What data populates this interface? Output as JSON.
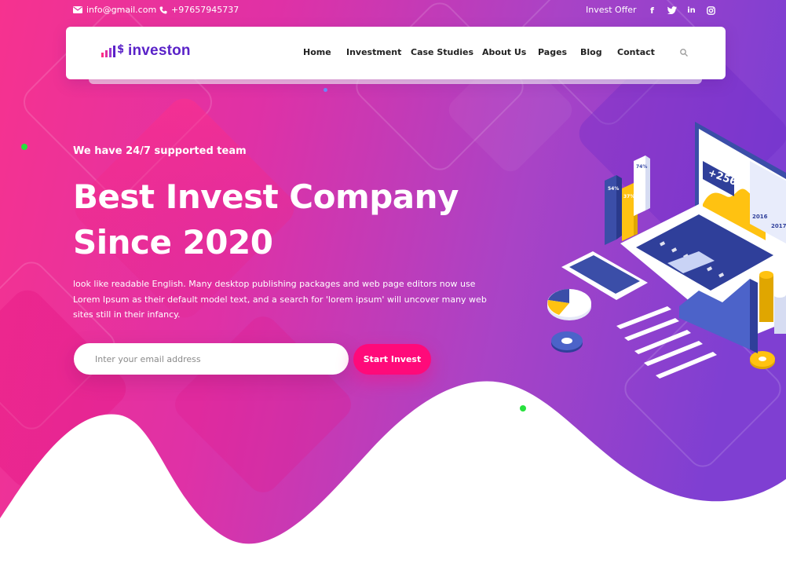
{
  "topbar": {
    "email": "info@gmail.com",
    "phone": "+97657945737",
    "offer": "Invest Offer",
    "social": [
      "facebook-icon",
      "twitter-icon",
      "linkedin-icon",
      "instagram-icon"
    ]
  },
  "brand": {
    "name": "investon",
    "accent": "#5a22c8",
    "pink": "#ff0a7a"
  },
  "nav": {
    "items": [
      {
        "label": "Home"
      },
      {
        "label": "Investment"
      },
      {
        "label": "Case Studies"
      },
      {
        "label": "About Us"
      },
      {
        "label": "Pages"
      },
      {
        "label": "Blog"
      },
      {
        "label": "Contact"
      }
    ],
    "search_icon": "search-icon"
  },
  "hero": {
    "eyebrow": "We have 24/7 supported team",
    "headline_line1": "Best Invest Company",
    "headline_line2": "Since 2020",
    "description": "look like readable English. Many desktop publishing packages and web page editors now use Lorem Ipsum as their default model text, and a search for 'lorem ipsum' will uncover many web sites still in their infancy.",
    "email_placeholder": "Inter your email address",
    "cta_label": "Start Invest"
  },
  "illustration": {
    "screen_label": "+256",
    "years": [
      "2016",
      "2017"
    ],
    "bar_labels": [
      "54%",
      "37%",
      "74%"
    ]
  }
}
